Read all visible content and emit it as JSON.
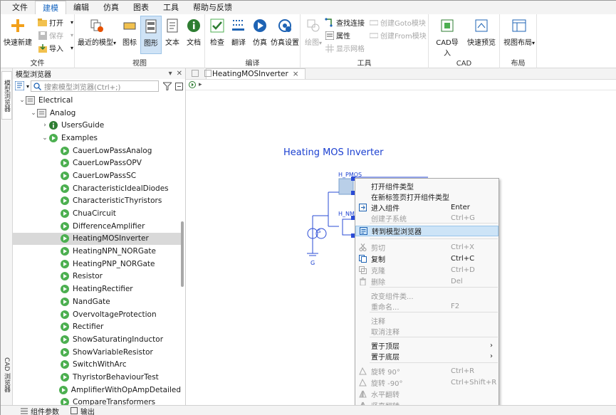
{
  "menubar": {
    "items": [
      "文件",
      "建模",
      "编辑",
      "仿真",
      "图表",
      "工具",
      "帮助与反馈"
    ],
    "active_index": 1
  },
  "ribbon": {
    "file_group": {
      "label": "文件",
      "quick_new": "快速新建",
      "open": "打开",
      "save": "保存",
      "import": "导入"
    },
    "view_group": {
      "label": "视图",
      "recent": "最近的模型",
      "icon": "图标",
      "diagram": "图形",
      "text": "文本",
      "docs": "文档"
    },
    "compile_group": {
      "label": "编译",
      "check": "检查",
      "translate": "翻译",
      "simulate": "仿真",
      "sim_settings": "仿真设置"
    },
    "tools_group": {
      "label": "工具",
      "draw": "绘图",
      "find_conn": "查找连接",
      "props": "属性",
      "show_grid": "显示网格",
      "goto": "创建Goto模块",
      "from": "创建From模块"
    },
    "cad_group": {
      "label": "CAD",
      "cad_import": "CAD导入",
      "quick_preview": "快速预览"
    },
    "layout_group": {
      "label": "布局",
      "view_layout": "视图布局"
    }
  },
  "left_tabs": {
    "model_browser": "模型浏览器",
    "cad_browser": "CAD 浏览器"
  },
  "browser": {
    "title": "模型浏览器",
    "search_placeholder": "搜索模型浏览器(Ctrl+;)",
    "tree": [
      {
        "label": "Electrical",
        "level": 0,
        "icon": "package",
        "expanded": true
      },
      {
        "label": "Analog",
        "level": 1,
        "icon": "package",
        "expanded": true
      },
      {
        "label": "UsersGuide",
        "level": 2,
        "icon": "info",
        "expanded": false
      },
      {
        "label": "Examples",
        "level": 2,
        "icon": "play",
        "expanded": true
      },
      {
        "label": "CauerLowPassAnalog",
        "level": 3,
        "icon": "play"
      },
      {
        "label": "CauerLowPassOPV",
        "level": 3,
        "icon": "play"
      },
      {
        "label": "CauerLowPassSC",
        "level": 3,
        "icon": "play"
      },
      {
        "label": "CharacteristicIdealDiodes",
        "level": 3,
        "icon": "play"
      },
      {
        "label": "CharacteristicThyristors",
        "level": 3,
        "icon": "play"
      },
      {
        "label": "ChuaCircuit",
        "level": 3,
        "icon": "play"
      },
      {
        "label": "DifferenceAmplifier",
        "level": 3,
        "icon": "play"
      },
      {
        "label": "HeatingMOSInverter",
        "level": 3,
        "icon": "play",
        "selected": true
      },
      {
        "label": "HeatingNPN_NORGate",
        "level": 3,
        "icon": "play"
      },
      {
        "label": "HeatingPNP_NORGate",
        "level": 3,
        "icon": "play"
      },
      {
        "label": "Resistor",
        "level": 3,
        "icon": "play"
      },
      {
        "label": "HeatingRectifier",
        "level": 3,
        "icon": "play"
      },
      {
        "label": "NandGate",
        "level": 3,
        "icon": "play"
      },
      {
        "label": "OvervoltageProtection",
        "level": 3,
        "icon": "play"
      },
      {
        "label": "Rectifier",
        "level": 3,
        "icon": "play"
      },
      {
        "label": "ShowSaturatingInductor",
        "level": 3,
        "icon": "play"
      },
      {
        "label": "ShowVariableResistor",
        "level": 3,
        "icon": "play"
      },
      {
        "label": "SwitchWithArc",
        "level": 3,
        "icon": "play"
      },
      {
        "label": "ThyristorBehaviourTest",
        "level": 3,
        "icon": "play"
      },
      {
        "label": "AmplifierWithOpAmpDetailed",
        "level": 3,
        "icon": "play"
      },
      {
        "label": "CompareTransformers",
        "level": 3,
        "icon": "play"
      }
    ]
  },
  "bottom": {
    "params": "组件参数",
    "output": "输出"
  },
  "editor": {
    "tab_label": "HeatingMOSInverter",
    "close": "×",
    "model_title": "Heating MOS Inverter",
    "labels": {
      "pmos": "H_PMOS",
      "nmos": "H_NM",
      "ground": "G",
      "source": "S"
    }
  },
  "context_menu": {
    "items": [
      {
        "label": "打开组件类型",
        "shortcut": "",
        "disabled": false
      },
      {
        "label": "在新标签页打开组件类型",
        "shortcut": "",
        "disabled": false
      },
      {
        "label": "进入组件",
        "shortcut": "Enter",
        "disabled": false,
        "icon": "enter"
      },
      {
        "label": "创建子系统",
        "shortcut": "Ctrl+G",
        "disabled": true
      },
      {
        "label": "转到模型浏览器",
        "shortcut": "",
        "disabled": false,
        "highlight": true,
        "icon": "browser"
      },
      {
        "label": "剪切",
        "shortcut": "Ctrl+X",
        "disabled": true,
        "icon": "scissors"
      },
      {
        "label": "复制",
        "shortcut": "Ctrl+C",
        "disabled": false,
        "icon": "copy"
      },
      {
        "label": "克隆",
        "shortcut": "Ctrl+D",
        "disabled": true,
        "icon": "clone"
      },
      {
        "label": "删除",
        "shortcut": "Del",
        "disabled": true,
        "icon": "trash"
      },
      {
        "label": "改变组件类...",
        "shortcut": "",
        "disabled": true
      },
      {
        "label": "重命名...",
        "shortcut": "F2",
        "disabled": true
      },
      {
        "label": "注释",
        "shortcut": "",
        "disabled": true
      },
      {
        "label": "取消注释",
        "shortcut": "",
        "disabled": true
      },
      {
        "label": "置于顶层",
        "shortcut": "",
        "disabled": false,
        "submenu": true
      },
      {
        "label": "置于底层",
        "shortcut": "",
        "disabled": false,
        "submenu": true
      },
      {
        "label": "旋转 90°",
        "shortcut": "Ctrl+R",
        "disabled": true,
        "icon": "rotate"
      },
      {
        "label": "旋转 -90°",
        "shortcut": "Ctrl+Shift+R",
        "disabled": true,
        "icon": "rotate"
      },
      {
        "label": "水平翻转",
        "shortcut": "",
        "disabled": true,
        "icon": "flip"
      },
      {
        "label": "竖直翻转",
        "shortcut": "",
        "disabled": true,
        "icon": "flip"
      }
    ]
  },
  "colors": {
    "accent": "#1565c0",
    "title_blue": "#1a3fd0",
    "highlight": "#cde4f7",
    "play_green": "#4caf50"
  }
}
